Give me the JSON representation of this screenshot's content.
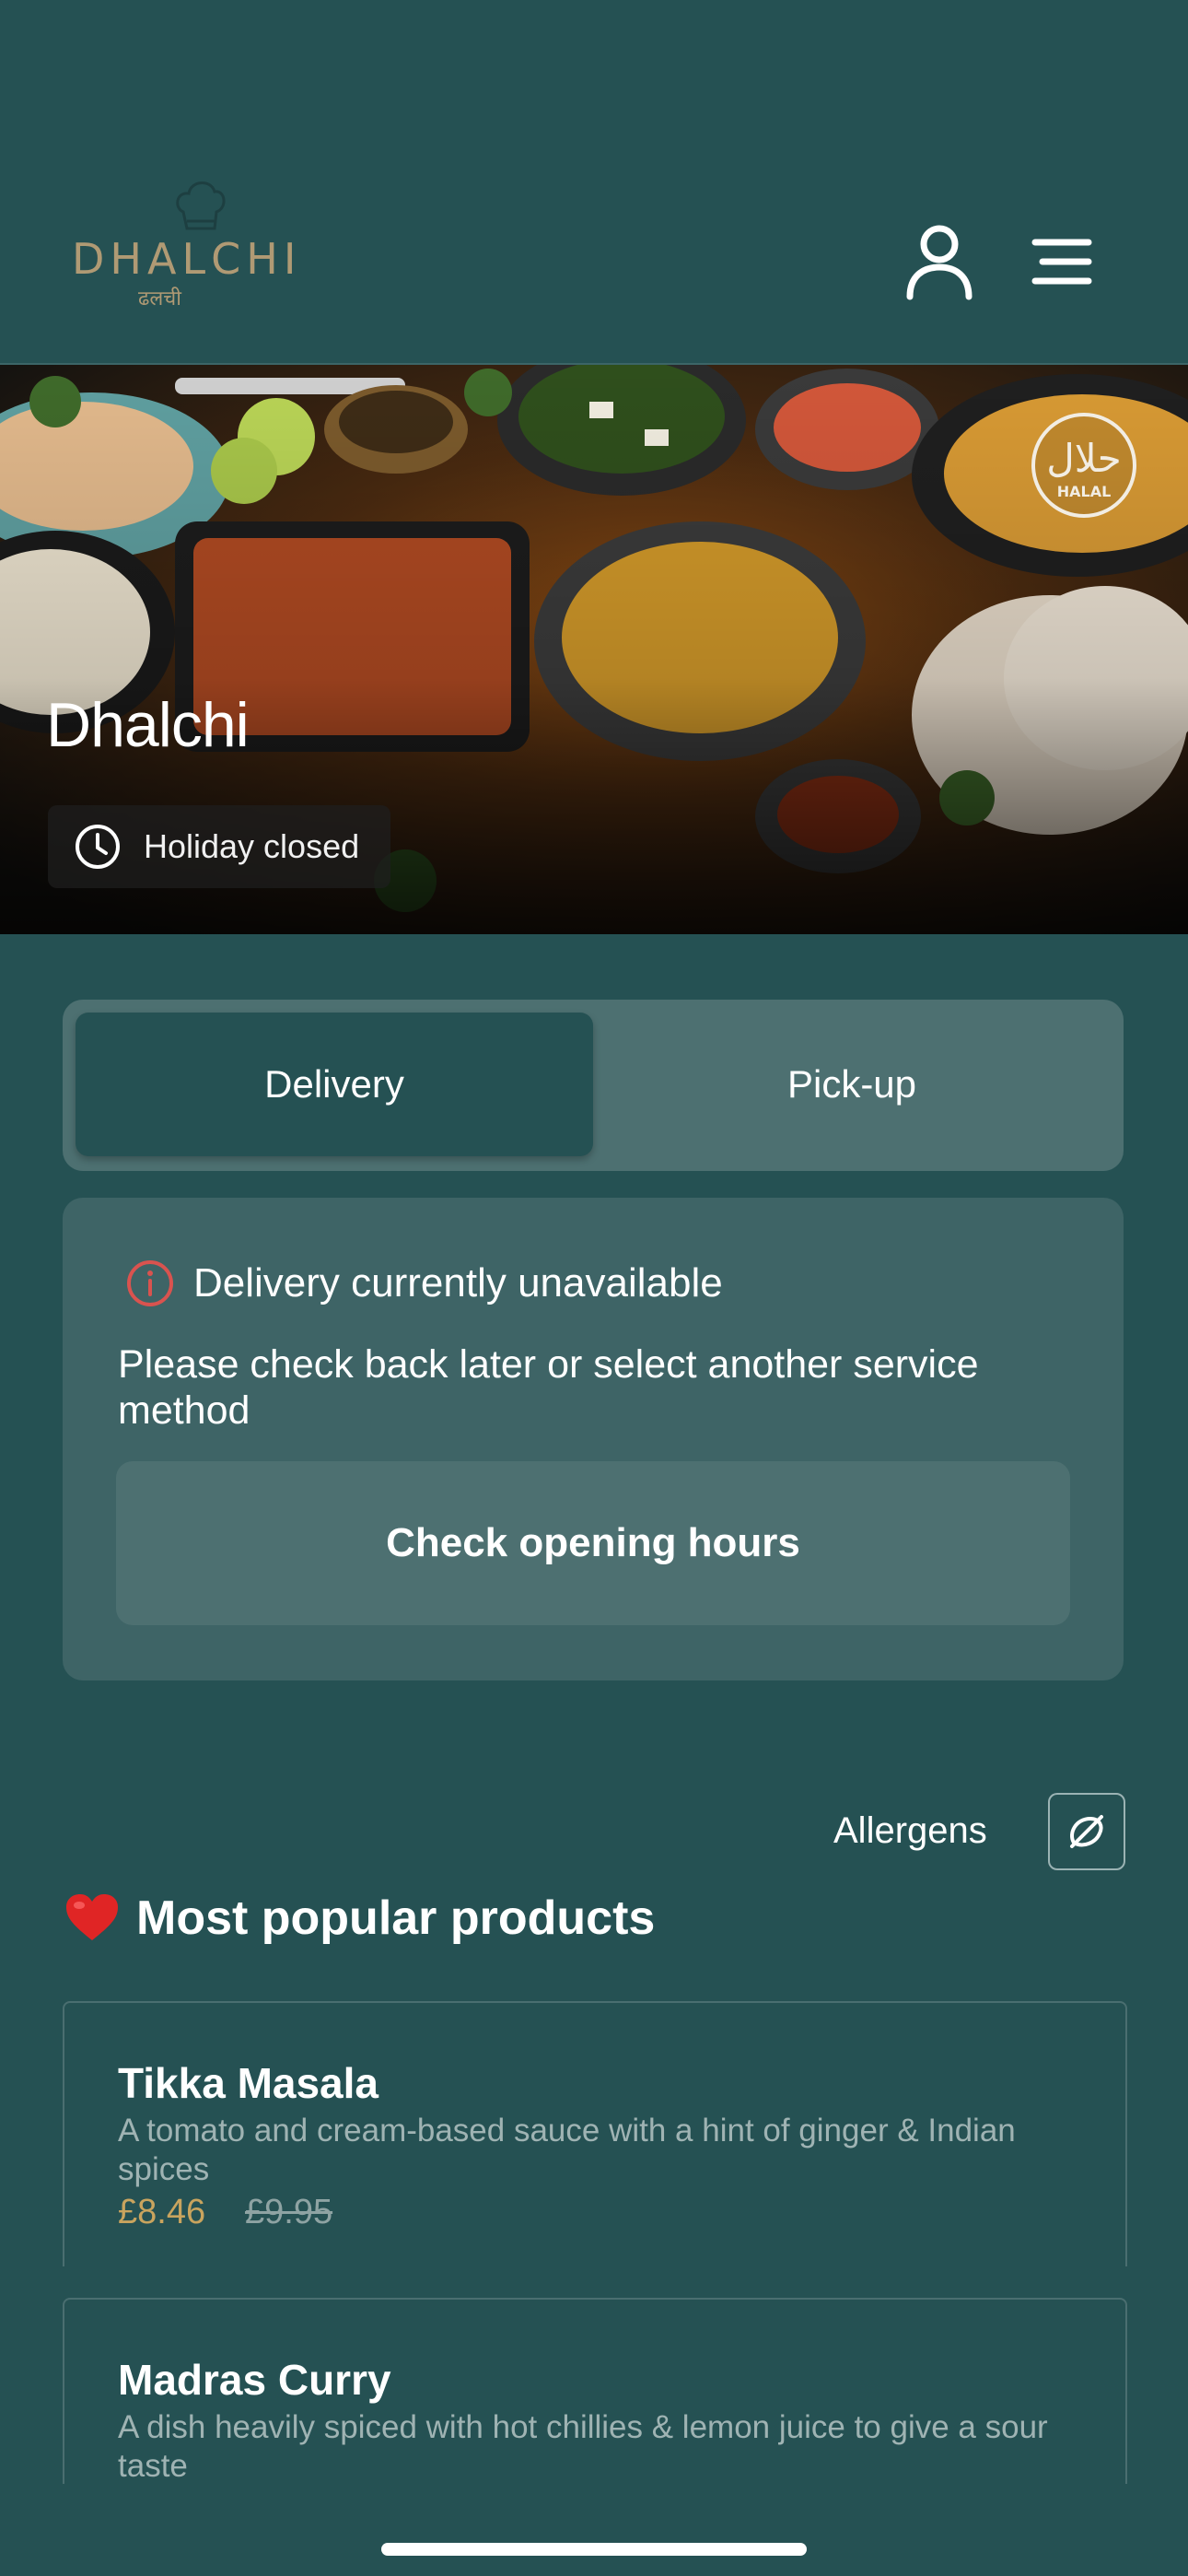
{
  "header": {
    "logo_text": "DHALCHI",
    "logo_subtext": "ढलची",
    "profile_icon": "user-icon",
    "menu_icon": "hamburger-menu-icon"
  },
  "hero": {
    "restaurant_name": "Dhalchi",
    "status": "Holiday closed",
    "status_icon": "clock-icon",
    "badge_text": "HALAL",
    "badge_arabic": "حلال"
  },
  "service_toggle": {
    "options": [
      {
        "label": "Delivery",
        "selected": true
      },
      {
        "label": "Pick-up",
        "selected": false
      }
    ]
  },
  "notice": {
    "icon": "warning-circle-icon",
    "title": "Delivery currently unavailable",
    "message": "Please check back later or select another service method",
    "button_label": "Check opening hours"
  },
  "allergens": {
    "label": "Allergens",
    "icon": "allergen-filter-icon"
  },
  "popular": {
    "emoji": "❤️",
    "title": "Most popular products",
    "products": [
      {
        "name": "Tikka Masala",
        "description": "A tomato and cream-based sauce with a hint of ginger & Indian spices",
        "price": "£8.46",
        "original_price": "£9.95"
      },
      {
        "name": "Madras Curry",
        "description": "A dish heavily spiced with hot chillies & lemon juice to give a sour taste"
      }
    ]
  },
  "colors": {
    "background": "#255153",
    "accent_price": "#c9a45e",
    "warning": "#d9534f"
  }
}
